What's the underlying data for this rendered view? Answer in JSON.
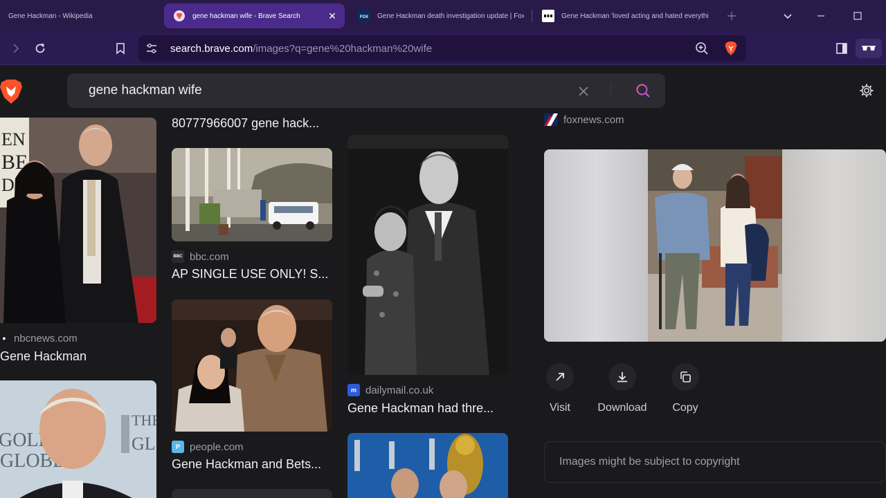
{
  "browser": {
    "tabs": [
      {
        "title": "Gene Hackman - Wikipedia",
        "active": false
      },
      {
        "title": "gene hackman wife - Brave Search",
        "active": true
      },
      {
        "title": "Gene Hackman death investigation update | Fox N",
        "active": false
      },
      {
        "title": "Gene Hackman 'loved acting and hated everything",
        "active": false
      }
    ],
    "url_host": "search.brave.com",
    "url_path": "/images?q=gene%20hackman%20wife",
    "colors": {
      "tabstrip": "#2a1a4a",
      "active_tab": "#4a2a8a",
      "toolbar": "#2c1a52",
      "brave_orange": "#fb542b"
    }
  },
  "search": {
    "query": "gene hackman wife"
  },
  "results": {
    "col1": [
      {
        "source": "nbcnews.com",
        "title": "Gene Hackman"
      }
    ],
    "col2": [
      {
        "source": "",
        "title": "80777966007 gene hack..."
      },
      {
        "source": "bbc.com",
        "title": "AP SINGLE USE ONLY! S..."
      },
      {
        "source": "people.com",
        "title": "Gene Hackman and Bets..."
      }
    ],
    "col3": [
      {
        "source": "dailymail.co.uk",
        "title": "Gene Hackman had thre..."
      }
    ]
  },
  "preview": {
    "source": "foxnews.com",
    "actions": {
      "visit": "Visit",
      "download": "Download",
      "copy": "Copy"
    },
    "copyright_notice": "Images might be subject to copyright"
  }
}
